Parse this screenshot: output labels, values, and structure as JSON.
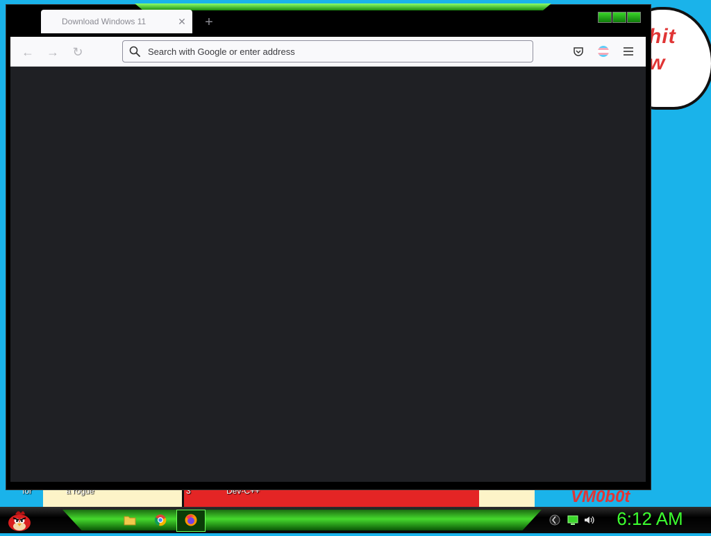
{
  "wallpaper": {
    "bubble_text": "hit\nw",
    "sign_text": "VM0b0t",
    "desktop_labels": [
      "for",
      "a rogue",
      "3",
      "Dev-C++"
    ]
  },
  "browser": {
    "tab": {
      "title": "Download Windows 11",
      "close_glyph": "✕"
    },
    "new_tab_glyph": "+",
    "nav": {
      "back_glyph": "←",
      "forward_glyph": "→",
      "reload_glyph": "↻"
    },
    "urlbar": {
      "placeholder": "Search with Google or enter address",
      "value": ""
    },
    "icons": [
      "pocket-icon",
      "account-icon",
      "menu-icon"
    ]
  },
  "taskbar": {
    "items": [
      "start-button",
      "file-explorer",
      "chrome",
      "firefox"
    ],
    "active_item": "firefox",
    "tray_icons": [
      "network-icon",
      "display-icon",
      "volume-icon"
    ],
    "clock": "6:12 AM",
    "accent_color": "#3cff2f"
  }
}
